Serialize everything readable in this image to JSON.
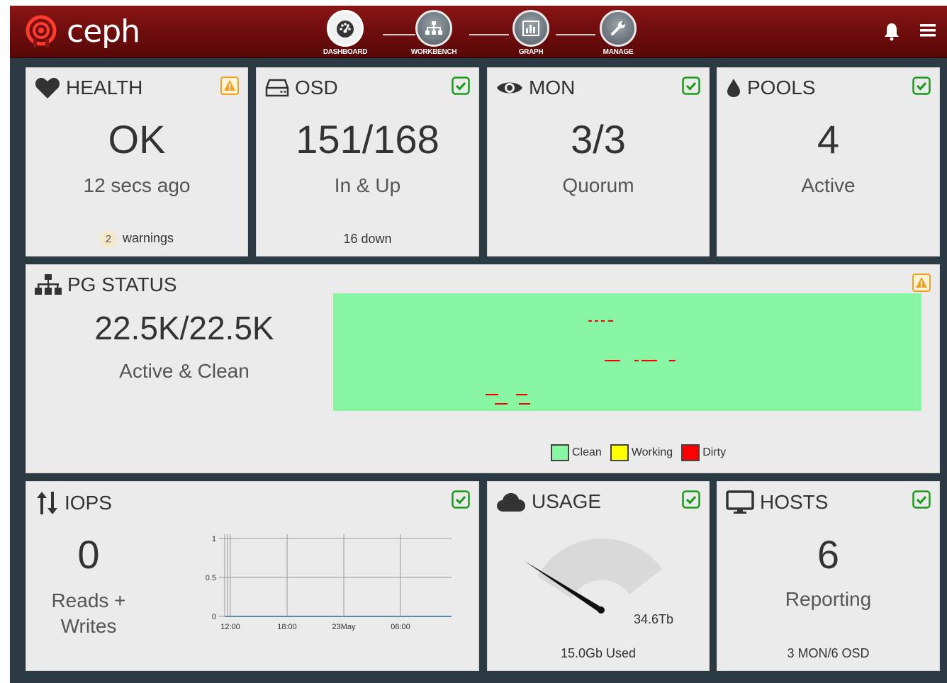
{
  "app": {
    "name": "ceph"
  },
  "nav": [
    {
      "label": "DASHBOARD",
      "icon": "dashboard-gauge-icon",
      "active": true
    },
    {
      "label": "WORKBENCH",
      "icon": "sitemap-icon",
      "active": false
    },
    {
      "label": "GRAPH",
      "icon": "bar-chart-icon",
      "active": false
    },
    {
      "label": "MANAGE",
      "icon": "wrench-icon",
      "active": false
    }
  ],
  "header_icons": {
    "notifications": "bell-icon",
    "menu": "hamburger-icon"
  },
  "colors": {
    "ok": "#1a9a1a",
    "warn": "#f0a020",
    "clean": "#88f5a2",
    "working": "#ffff00",
    "dirty": "#ff0000",
    "topbar": "#6b0c0c"
  },
  "health": {
    "title": "HEALTH",
    "status": "warning",
    "value": "OK",
    "sub": "12 secs ago",
    "warn_count": "2",
    "warn_label": "warnings"
  },
  "osd": {
    "title": "OSD",
    "status": "ok",
    "value": "151/168",
    "sub": "In & Up",
    "foot": "16 down"
  },
  "mon": {
    "title": "MON",
    "status": "ok",
    "value": "3/3",
    "sub": "Quorum"
  },
  "pools": {
    "title": "POOLS",
    "status": "ok",
    "value": "4",
    "sub": "Active"
  },
  "pg": {
    "title": "PG STATUS",
    "status": "warning",
    "value": "22.5K/22.5K",
    "sub": "Active & Clean",
    "legend": [
      {
        "label": "Clean",
        "color": "#88f5a2"
      },
      {
        "label": "Working",
        "color": "#ffff00"
      },
      {
        "label": "Dirty",
        "color": "#ff0000"
      }
    ]
  },
  "iops": {
    "title": "IOPS",
    "status": "ok",
    "value": "0",
    "sub_line1": "Reads +",
    "sub_line2": "Writes",
    "chart_data": {
      "type": "line",
      "x": [
        "12:00",
        "18:00",
        "23May",
        "06:00"
      ],
      "series": [
        {
          "values": [
            0,
            0,
            0,
            0
          ]
        }
      ],
      "yticks": [
        "1",
        "0.5",
        "0"
      ],
      "ylim": [
        0,
        1
      ],
      "grid": true
    }
  },
  "usage": {
    "title": "USAGE",
    "status": "ok",
    "capacity": "34.6Tb",
    "used": "15.0Gb Used",
    "fraction": 0.0004
  },
  "hosts": {
    "title": "HOSTS",
    "status": "ok",
    "value": "6",
    "sub": "Reporting",
    "foot": "3 MON/6 OSD"
  }
}
